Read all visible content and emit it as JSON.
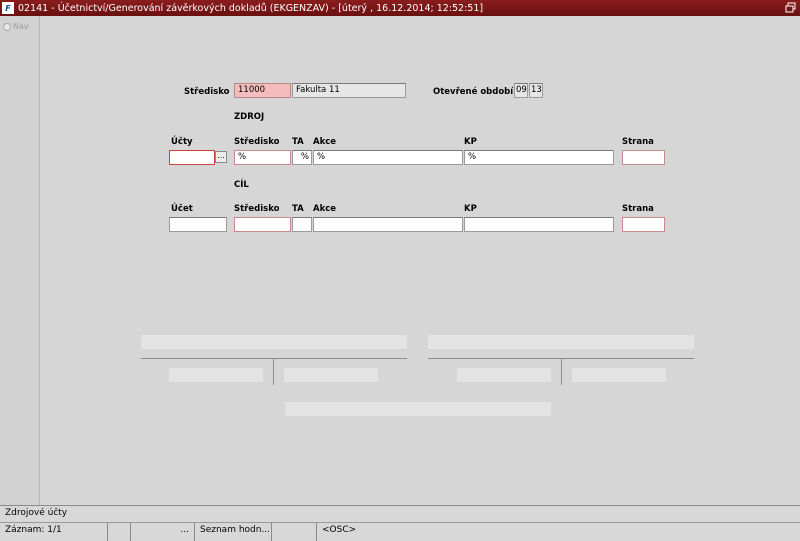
{
  "window": {
    "icon_letter": "F",
    "title": "02141 - Účetnictví/Generování závěrkových dokladů (EKGENZAV) - [úterý   , 16.12.2014; 12:52:51]"
  },
  "nav": {
    "label": "Nav"
  },
  "header_section": {
    "stredisko_label": "Středisko",
    "stredisko_code": "11000",
    "stredisko_name": "Fakulta 11",
    "obdobi_label": "Otevřené období",
    "obdobi_month": "09",
    "obdobi_year": "13"
  },
  "source": {
    "section_label": "ZDROJ",
    "col_ucty": "Účty",
    "col_stredisko": "Středisko",
    "col_ta": "TA",
    "col_akce": "Akce",
    "col_kp": "KP",
    "col_strana": "Strana",
    "ucty": "",
    "lov_button": "...",
    "stredisko": "%",
    "ta": "%",
    "akce": "%",
    "kp": "%",
    "strana": ""
  },
  "target": {
    "section_label": "CÍL",
    "col_ucet": "Účet",
    "col_stredisko": "Středisko",
    "col_ta": "TA",
    "col_akce": "Akce",
    "col_kp": "KP",
    "col_strana": "Strana",
    "ucet": "",
    "stredisko": "",
    "ta": "",
    "akce": "",
    "kp": "",
    "strana": ""
  },
  "status": {
    "hint": "Zdrojové účty",
    "record": "Záznam: 1/1",
    "cell2": "",
    "cell3": "...",
    "list": "Seznam hodn...",
    "cell5": "",
    "osc": "<OSC>"
  }
}
